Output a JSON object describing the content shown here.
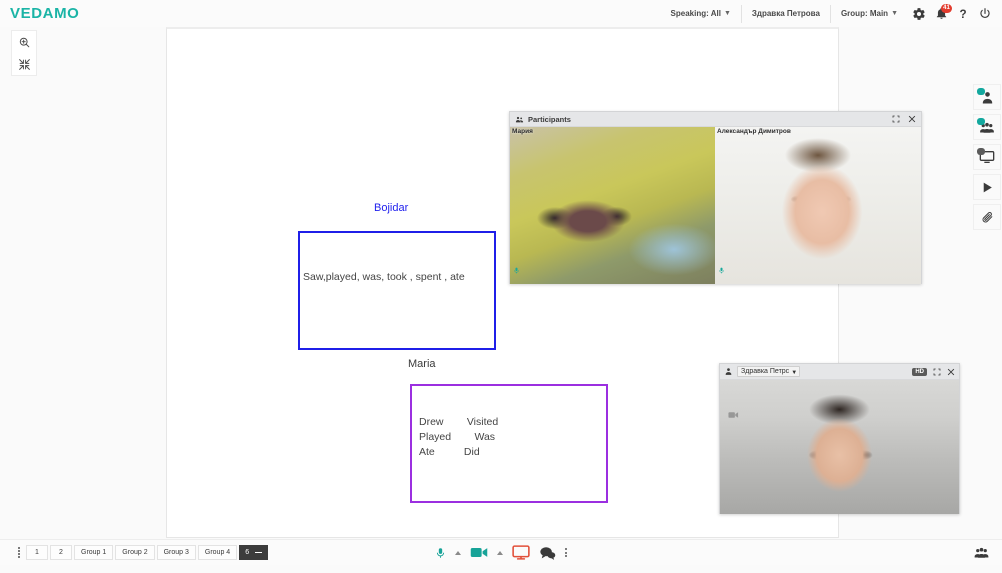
{
  "app": {
    "logo": "VEDAMO"
  },
  "topbar": {
    "speaking": "Speaking: All",
    "user": "Здравка Петрова",
    "group": "Group: Main",
    "settings_icon": "gear-icon",
    "notifications_icon": "bell-icon",
    "notifications_count": "41",
    "help_icon": "question-mark-icon",
    "power_icon": "power-icon",
    "accent_color": "#1ab4a6",
    "badge_color": "#e23c2e"
  },
  "left_tools": {
    "zoom_icon": "magnifier-zoom-in-icon",
    "fit_icon": "collapse-arrows-icon"
  },
  "whiteboard": {
    "items": [
      {
        "label": "Bojidar",
        "label_color": "#2222ee",
        "box_color": "#1f1fe8",
        "text": "Saw,played, was, took , spent , ate"
      },
      {
        "label": "Maria",
        "label_color": "#3a3a3a",
        "box_color": "#9b2fe0",
        "text": "Drew        Visited\nPlayed        Was\nAte          Did"
      }
    ]
  },
  "participants_panel": {
    "title": "Participants",
    "people_icon": "people-icon",
    "expand_icon": "expand-icon",
    "close_icon": "close-icon",
    "tiles": [
      {
        "name": "Мария",
        "mic_icon": "microphone-icon"
      },
      {
        "name": "Александър Димитров",
        "mic_icon": "microphone-icon"
      }
    ]
  },
  "self_video": {
    "person_icon": "person-icon",
    "selected_device": "Здравка Петрс",
    "hd_label": "HD",
    "expand_icon": "expand-icon",
    "close_icon": "close-icon",
    "camera_icon": "camera-icon"
  },
  "right_rail": {
    "items": [
      {
        "icon": "person-icon",
        "dot": "teal"
      },
      {
        "icon": "people-group-icon",
        "dot": "teal"
      },
      {
        "icon": "screen-monitor-icon",
        "dot": "gray"
      },
      {
        "icon": "play-icon",
        "dot": "none"
      },
      {
        "icon": "paperclip-icon",
        "dot": "none"
      }
    ]
  },
  "bottombar": {
    "drag_handle": "drag-handle-icon",
    "page_tabs": [
      {
        "label": "1",
        "active": false
      },
      {
        "label": "2",
        "active": false
      },
      {
        "label": "Group 1",
        "active": false
      },
      {
        "label": "Group 2",
        "active": false
      },
      {
        "label": "Group 3",
        "active": false
      },
      {
        "label": "Group 4",
        "active": false
      },
      {
        "label": "6",
        "active": true
      }
    ],
    "tools": [
      {
        "icon": "microphone-icon",
        "color": "#17a398"
      },
      {
        "icon": "chevron-up-icon",
        "color": "#8a8a8a"
      },
      {
        "icon": "camera-icon",
        "color": "#17a398"
      },
      {
        "icon": "chevron-up-icon",
        "color": "#8a8a8a"
      },
      {
        "icon": "screen-share-icon",
        "color": "#e2503a"
      },
      {
        "icon": "chat-bubbles-icon",
        "color": "#3a3a3a"
      },
      {
        "icon": "more-vertical-icon",
        "color": "#555555"
      }
    ],
    "right_icon": "people-group-icon"
  }
}
